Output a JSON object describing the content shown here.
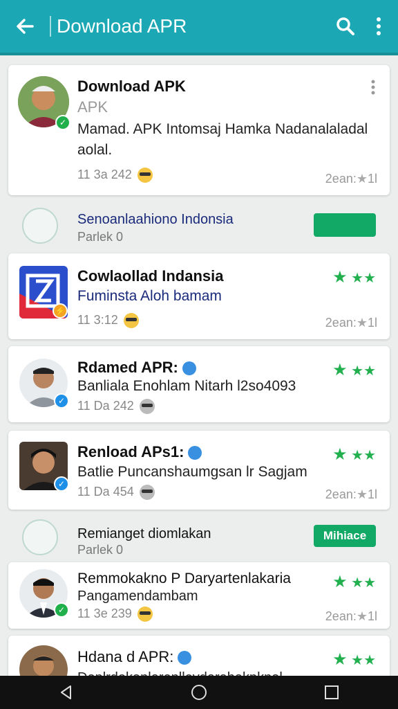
{
  "appbar": {
    "title": "Download APR"
  },
  "card1": {
    "name": "Download APK",
    "subtitle": "APK",
    "description": "Mamad. APK Intomsaj Hamka Nadanalaladal aolal.",
    "meta": "11 3a 242",
    "right": "2ean:",
    "rating": "1l"
  },
  "section1": {
    "title": "Senoanlaahiono Indonsia",
    "sub": "Parlek  0",
    "button": ""
  },
  "card2": {
    "name": "Cowlaollad Indansia",
    "subtitle": "Fuminsta Aloh  bamam",
    "meta": "11 3:12",
    "right": "2ean:",
    "rating": "1l"
  },
  "card3": {
    "name": "Rdamed APR:",
    "subtitle": "Banliala Enohlam Nitarh l2so4093",
    "meta": "11 Da 242"
  },
  "card4": {
    "name": "Renload APs1:",
    "subtitle": "Batlie Puncanshaumgsan lr  Sagjam",
    "meta": "11 Da 454",
    "right": "2ean:",
    "rating": "1l"
  },
  "section2": {
    "title": "Remianget diomlakan",
    "sub": "Parlek  0",
    "button": "Mihiace"
  },
  "card5": {
    "name": "Remmokakno P Daryartenlakaria",
    "subtitle": "Pangamendambam",
    "meta": "11 3e 239",
    "right": "2ean:",
    "rating": "1l"
  },
  "card6": {
    "name": "Hdana d APR:",
    "subtitle": "Deplrdokanlarenlleydarahakpknal"
  },
  "colors": {
    "accent": "#1ba7b3",
    "green": "#22b04f",
    "button": "#12a865"
  },
  "icons": [
    "back-arrow-icon",
    "search-icon",
    "more-vert-icon",
    "star-icon",
    "verified-badge-icon",
    "nav-back-icon",
    "nav-home-icon",
    "nav-recents-icon"
  ]
}
